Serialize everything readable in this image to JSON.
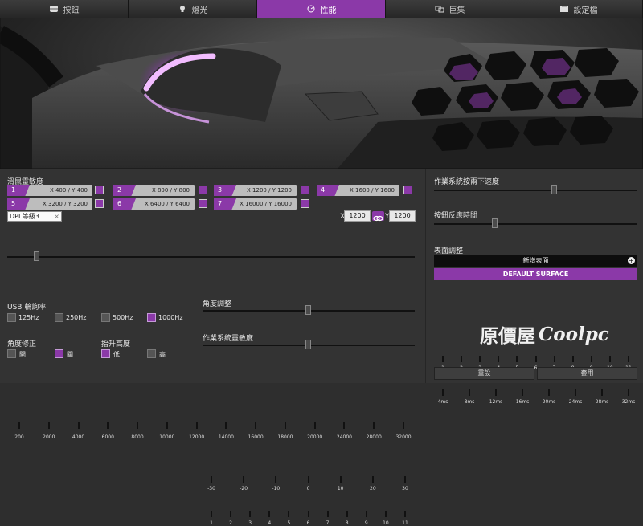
{
  "tabs": [
    {
      "label": "按鈕",
      "icon": "mouse-icon",
      "active": false
    },
    {
      "label": "燈光",
      "icon": "bulb-icon",
      "active": false
    },
    {
      "label": "性能",
      "icon": "performance-icon",
      "active": true
    },
    {
      "label": "巨集",
      "icon": "macro-icon",
      "active": false
    },
    {
      "label": "設定檔",
      "icon": "profile-icon",
      "active": false
    }
  ],
  "sensitivity": {
    "title": "滑鼠靈敏度",
    "slots": [
      {
        "num": "1",
        "value": "X 400 / Y 400"
      },
      {
        "num": "2",
        "value": "X 800 / Y 800"
      },
      {
        "num": "3",
        "value": "X 1200 / Y 1200"
      },
      {
        "num": "4",
        "value": "X 1600 / Y 1600"
      },
      {
        "num": "5",
        "value": "X 3200 / Y 3200"
      },
      {
        "num": "6",
        "value": "X 6400 / Y 6400"
      },
      {
        "num": "7",
        "value": "X 16000 / Y 16000"
      }
    ],
    "dpi_label": "DPI",
    "dpi_level": "等級3",
    "x_label": "X",
    "x_value": "1200",
    "y_label": "Y",
    "y_value": "1200",
    "scale": [
      "200",
      "2000",
      "4000",
      "6000",
      "8000",
      "10000",
      "12000",
      "14000",
      "16000",
      "18000",
      "20000",
      "24000",
      "28000",
      "32000"
    ],
    "current": 1200
  },
  "polling": {
    "title": "USB 輪詢率",
    "options": [
      {
        "label": "125Hz",
        "checked": false
      },
      {
        "label": "250Hz",
        "checked": false
      },
      {
        "label": "500Hz",
        "checked": false
      },
      {
        "label": "1000Hz",
        "checked": true
      }
    ]
  },
  "angle_snap": {
    "title": "角度修正",
    "options": [
      {
        "label": "開",
        "checked": false
      },
      {
        "label": "關",
        "checked": true
      }
    ]
  },
  "lift_off": {
    "title": "抬升高度",
    "options": [
      {
        "label": "低",
        "checked": true
      },
      {
        "label": "高",
        "checked": false
      }
    ]
  },
  "angle_adjust": {
    "title": "角度調整",
    "ticks": [
      "-30",
      "-20",
      "-10",
      "0",
      "10",
      "20",
      "30"
    ],
    "value": "0"
  },
  "os_sensitivity": {
    "title": "作業系統靈敏度",
    "ticks": [
      "1",
      "2",
      "3",
      "4",
      "5",
      "6",
      "7",
      "8",
      "9",
      "10",
      "11"
    ],
    "value": "6"
  },
  "double_click": {
    "title": "作業系統按兩下速度",
    "ticks": [
      "1",
      "2",
      "3",
      "4",
      "5",
      "6",
      "7",
      "8",
      "9",
      "10",
      "11"
    ],
    "value": "7"
  },
  "debounce": {
    "title": "按鈕反應時間",
    "ticks": [
      "4ms",
      "8ms",
      "12ms",
      "16ms",
      "20ms",
      "24ms",
      "28ms",
      "32ms"
    ],
    "value": "12ms"
  },
  "surface": {
    "title": "表面調整",
    "new_surface": "新增表面",
    "default_surface": "DEFAULT SURFACE"
  },
  "actions": {
    "reset": "重設",
    "apply": "套用"
  },
  "watermark": {
    "cn": "原價屋",
    "brand": "Coolpc"
  },
  "colors": {
    "accent": "#8b39a8",
    "glow": "#e9a7ff"
  }
}
